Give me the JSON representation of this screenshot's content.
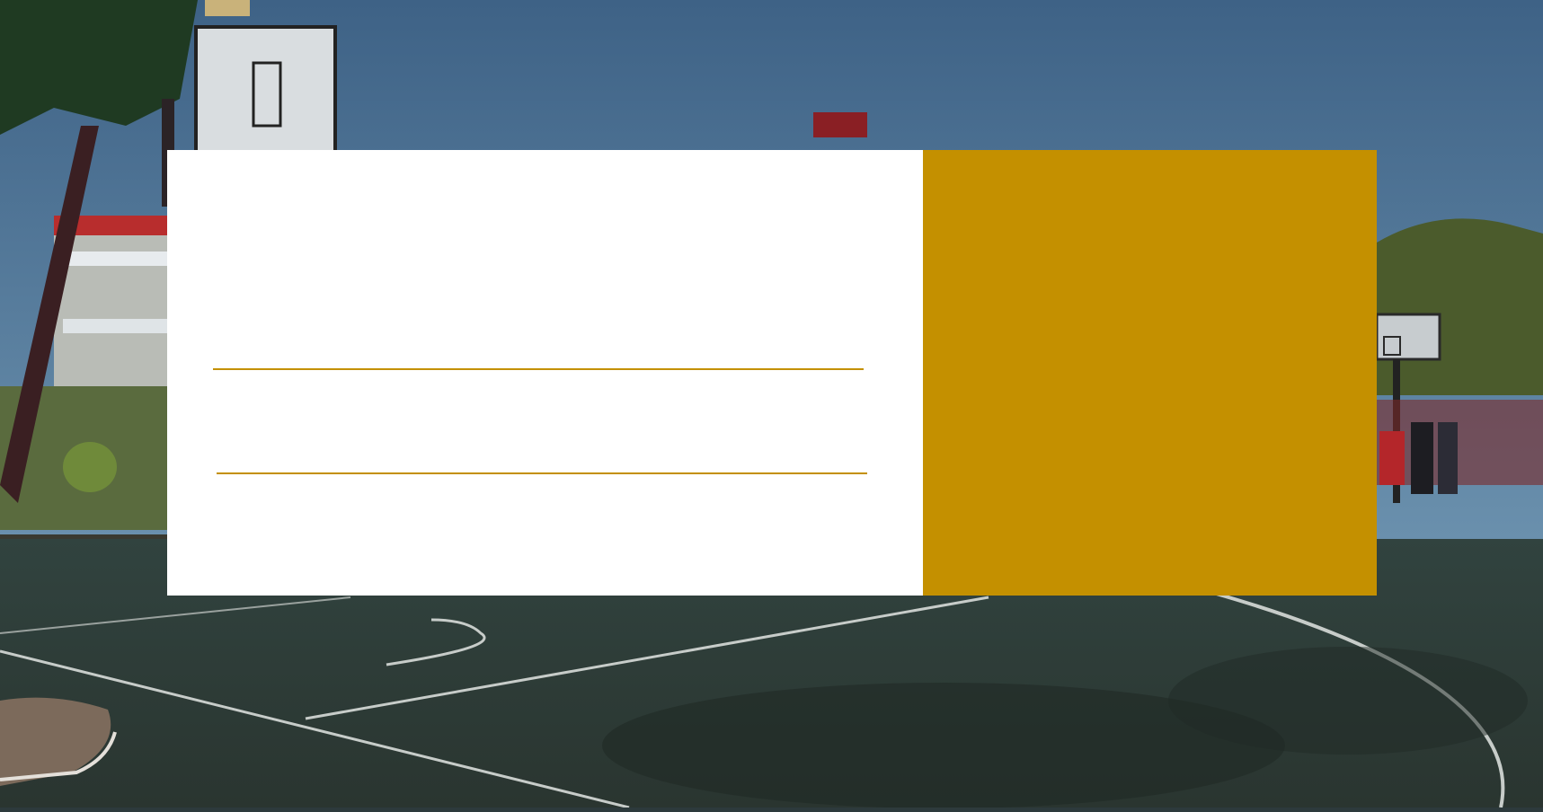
{
  "colors": {
    "accent_gold": "#c49000",
    "card_white": "#ffffff",
    "sky": "#4c6f93",
    "court": "#35453f"
  },
  "background": {
    "description_icon": "basketball-court-photo-icon"
  },
  "slide": {
    "title": "",
    "subtitle": "",
    "side_panel_text": ""
  }
}
